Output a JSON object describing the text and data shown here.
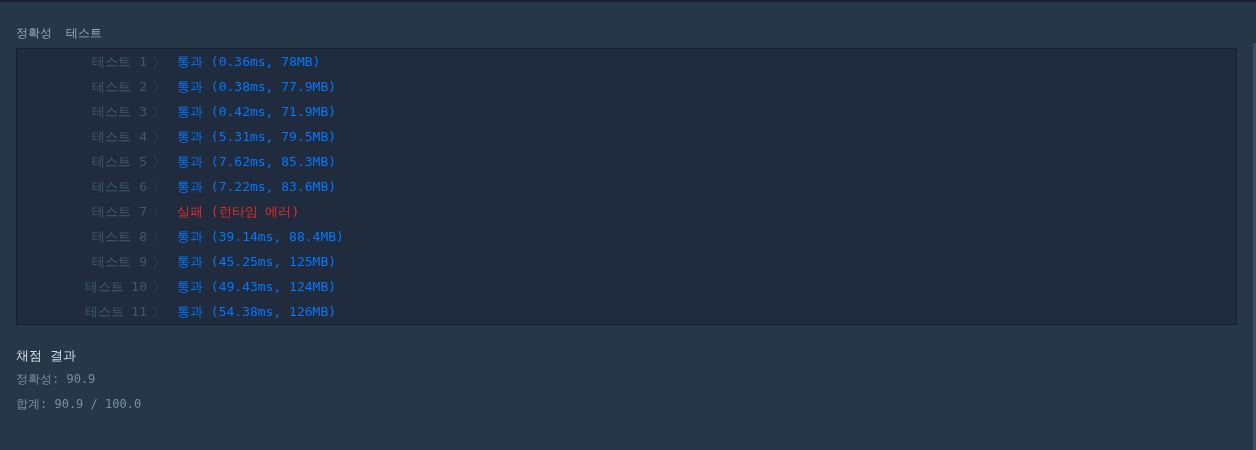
{
  "section_title": "정확성  테스트",
  "tests": [
    {
      "label": "테스트 1",
      "kind": "pass",
      "result": "통과 (0.36ms, 78MB)"
    },
    {
      "label": "테스트 2",
      "kind": "pass",
      "result": "통과 (0.38ms, 77.9MB)"
    },
    {
      "label": "테스트 3",
      "kind": "pass",
      "result": "통과 (0.42ms, 71.9MB)"
    },
    {
      "label": "테스트 4",
      "kind": "pass",
      "result": "통과 (5.31ms, 79.5MB)"
    },
    {
      "label": "테스트 5",
      "kind": "pass",
      "result": "통과 (7.62ms, 85.3MB)"
    },
    {
      "label": "테스트 6",
      "kind": "pass",
      "result": "통과 (7.22ms, 83.6MB)"
    },
    {
      "label": "테스트 7",
      "kind": "fail",
      "result": "실패 (런타임 에러)"
    },
    {
      "label": "테스트 8",
      "kind": "pass",
      "result": "통과 (39.14ms, 88.4MB)"
    },
    {
      "label": "테스트 9",
      "kind": "pass",
      "result": "통과 (45.25ms, 125MB)"
    },
    {
      "label": "테스트 10",
      "kind": "pass",
      "result": "통과 (49.43ms, 124MB)"
    },
    {
      "label": "테스트 11",
      "kind": "pass",
      "result": "통과 (54.38ms, 126MB)"
    }
  ],
  "summary": {
    "title": "채점 결과",
    "lines": [
      "정확성: 90.9",
      "합계: 90.9 / 100.0"
    ]
  }
}
